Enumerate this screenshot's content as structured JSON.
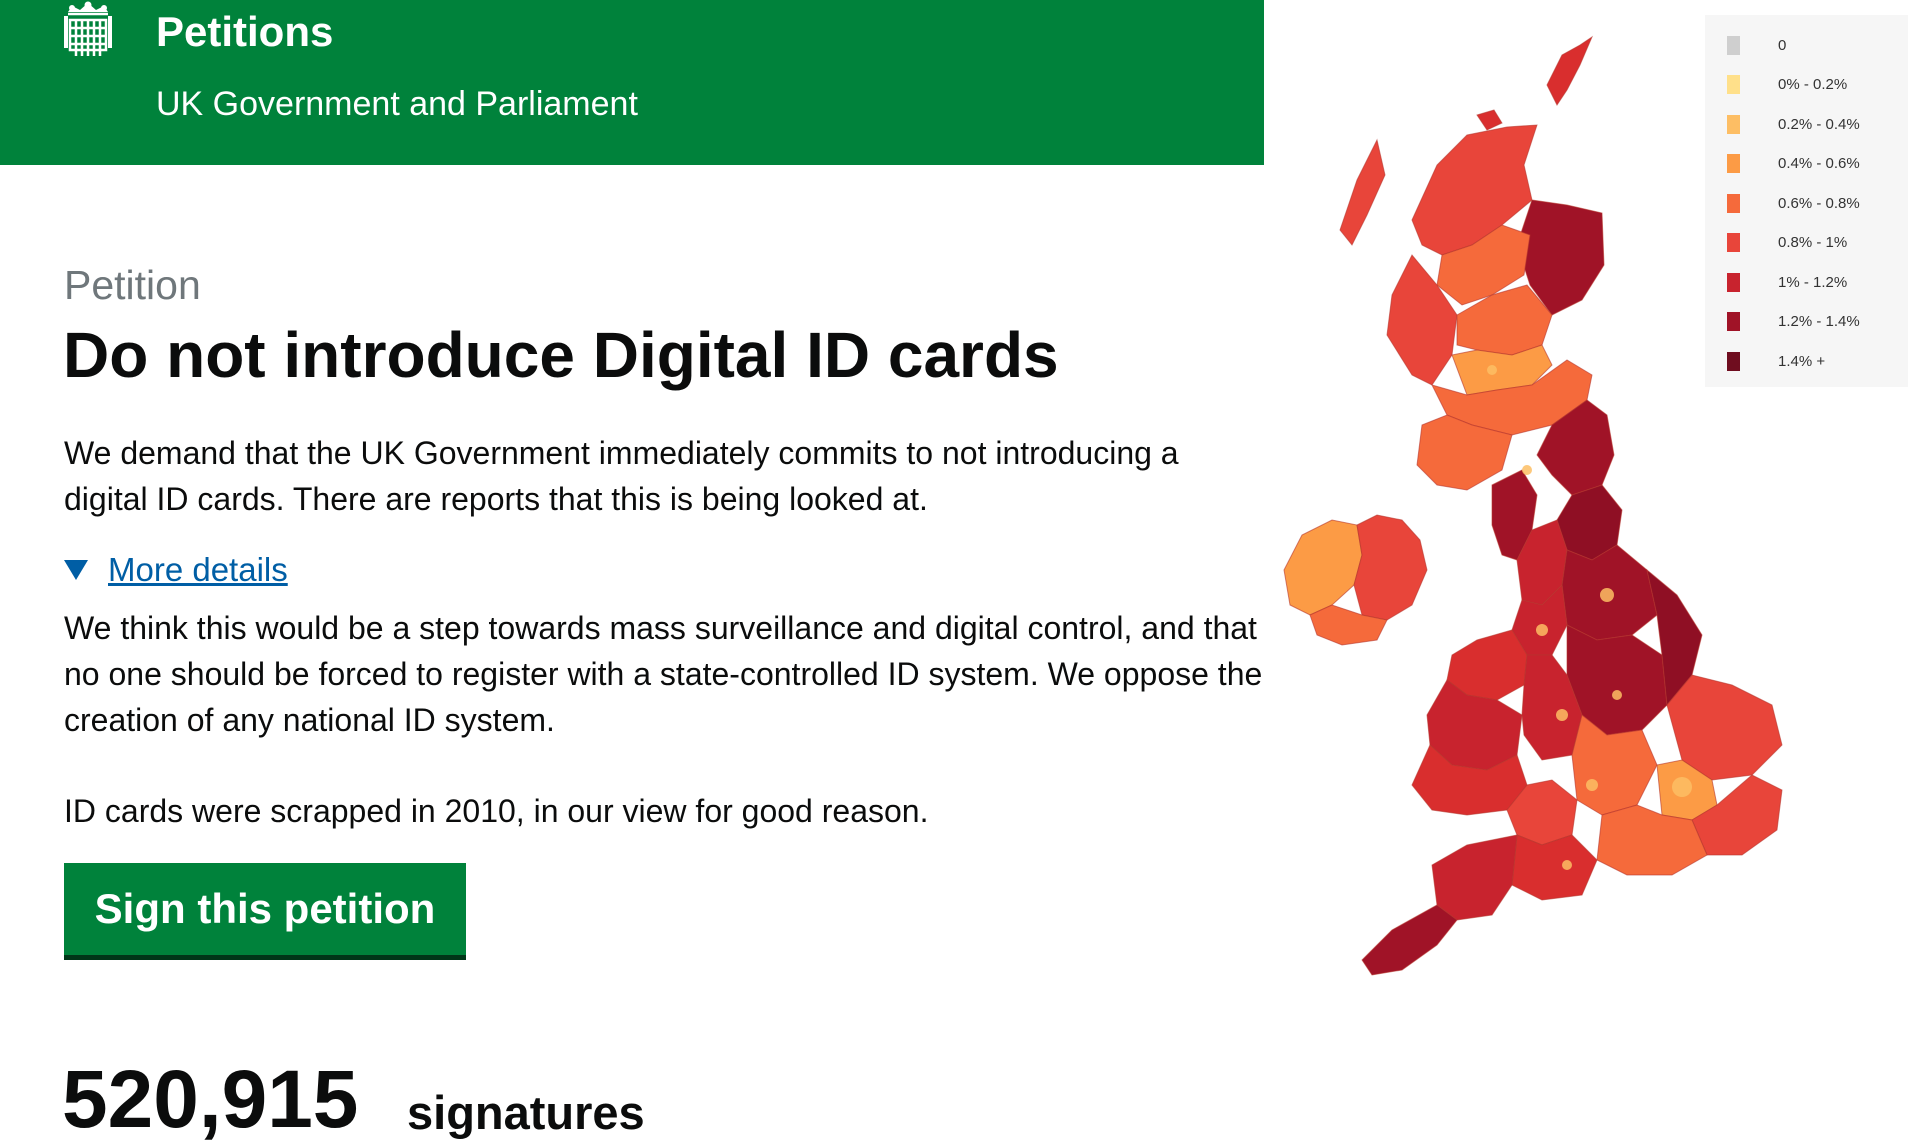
{
  "header": {
    "title": "Petitions",
    "subtitle": "UK Government and Parliament"
  },
  "petition": {
    "caption": "Petition",
    "title": "Do not introduce Digital ID cards",
    "summary": "We demand that the UK Government immediately commits to not introducing a digital ID cards. There are reports that this is being looked at.",
    "details_label": "More details",
    "details_p1": "We think this would be a step towards mass surveillance and digital control, and that no one should be forced to register with a state-controlled ID system. We oppose the creation of any national ID system.",
    "details_p2": "ID cards were scrapped in 2010, in our view for good reason.",
    "sign_button": "Sign this petition",
    "signature_count": "520,915",
    "signature_label": "signatures"
  },
  "map_legend": [
    {
      "label": "0",
      "color": "#cfcfcf"
    },
    {
      "label": "0% - 0.2%",
      "color": "#ffe08a"
    },
    {
      "label": "0.2% - 0.4%",
      "color": "#fdbe64"
    },
    {
      "label": "0.4% - 0.6%",
      "color": "#fc9b45"
    },
    {
      "label": "0.6% - 0.8%",
      "color": "#f56a3b"
    },
    {
      "label": "0.8% - 1%",
      "color": "#e8453a"
    },
    {
      "label": "1% - 1.2%",
      "color": "#c8232e"
    },
    {
      "label": "1.2% - 1.4%",
      "color": "#a01327"
    },
    {
      "label": "1.4% +",
      "color": "#6f0d1f"
    }
  ],
  "colors": {
    "header_green": "#00823b",
    "link_blue": "#005ea5",
    "text": "#0b0c0c",
    "caption_grey": "#6f777b"
  }
}
